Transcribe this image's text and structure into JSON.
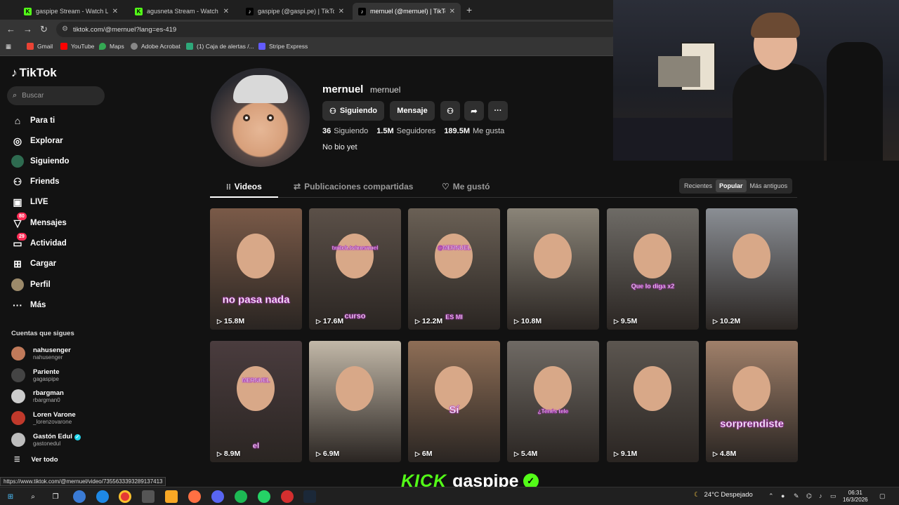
{
  "browser": {
    "tabs": [
      {
        "title": "gaspipe Stream - Watch Live o",
        "favicon": "kick-icon",
        "active": false
      },
      {
        "title": "agusneta Stream - Watch Live o",
        "favicon": "kick-icon",
        "active": false
      },
      {
        "title": "gaspipe (@gaspi.pe) | TikTok",
        "favicon": "tiktok-icon",
        "active": false
      },
      {
        "title": "mernuel (@mernuel) | TikTok",
        "favicon": "tiktok-icon",
        "active": true
      }
    ],
    "url": "tiktok.com/@mernuel?lang=es-419",
    "bookmarks": [
      "Gmail",
      "YouTube",
      "Maps",
      "Adobe Acrobat",
      "(1) Caja de alertas /...",
      "Stripe Express"
    ],
    "status_url": "https://www.tiktok.com/@mernuel/video/7355633393289137413"
  },
  "sidebar": {
    "logo": "TikTok",
    "search_placeholder": "Buscar",
    "nav": [
      {
        "label": "Para ti",
        "icon": "home-icon"
      },
      {
        "label": "Explorar",
        "icon": "compass-icon"
      },
      {
        "label": "Siguiendo",
        "icon": "following-icon"
      },
      {
        "label": "Friends",
        "icon": "friends-icon"
      },
      {
        "label": "LIVE",
        "icon": "live-icon"
      },
      {
        "label": "Mensajes",
        "icon": "messages-icon",
        "badge": "80"
      },
      {
        "label": "Actividad",
        "icon": "activity-icon",
        "badge": "29"
      },
      {
        "label": "Cargar",
        "icon": "upload-icon"
      },
      {
        "label": "Perfil",
        "icon": "profile-icon"
      },
      {
        "label": "Más",
        "icon": "more-icon"
      }
    ],
    "following_title": "Cuentas que sigues",
    "accounts": [
      {
        "name": "nahusenger",
        "handle": "nahusenger",
        "verified": false
      },
      {
        "name": "Pariente",
        "handle": "gagaspipe",
        "verified": false
      },
      {
        "name": "rbargman",
        "handle": "rbargman0",
        "verified": false
      },
      {
        "name": "Loren Varone",
        "handle": "_lorenzovarone",
        "verified": false
      },
      {
        "name": "Gastón Edul",
        "handle": "gastonedul",
        "verified": true
      }
    ],
    "see_all": "Ver todo"
  },
  "profile": {
    "username": "mernuel",
    "nickname": "mernuel",
    "buttons": {
      "following": "Siguiendo",
      "message": "Mensaje"
    },
    "stats": [
      {
        "value": "36",
        "label": "Siguiendo"
      },
      {
        "value": "1.5M",
        "label": "Seguidores"
      },
      {
        "value": "189.5M",
        "label": "Me gusta"
      }
    ],
    "bio": "No bio yet",
    "tabs": [
      "Videos",
      "Publicaciones compartidas",
      "Me gustó"
    ],
    "sort_options": [
      "Recientes",
      "Popular",
      "Más antiguos"
    ],
    "sort_selected": "Popular"
  },
  "videos": [
    {
      "views": "15.8M",
      "caption": "no pasa nada",
      "bg": "#7a5a48"
    },
    {
      "views": "17.6M",
      "caption": "curso",
      "overlay": "twitch.tv/mernuel",
      "bg": "#5b5048"
    },
    {
      "views": "12.2M",
      "caption": "ES MI",
      "overlay": "@MERNUEL",
      "bg": "#6a6055"
    },
    {
      "views": "10.8M",
      "caption": "",
      "bg": "#8a8478"
    },
    {
      "views": "9.5M",
      "caption": "Que lo diga x2",
      "bg": "#6e6b66"
    },
    {
      "views": "10.2M",
      "caption": "",
      "bg": "#8a8e94"
    },
    {
      "views": "8.9M",
      "caption": "el",
      "overlay": "MERNUEL",
      "bg": "#4a3c3e"
    },
    {
      "views": "6.9M",
      "caption": "",
      "bg": "#c2b8a8"
    },
    {
      "views": "6M",
      "caption": "Sí",
      "bg": "#8e6e56"
    },
    {
      "views": "5.4M",
      "caption": "¿Tenés tele",
      "bg": "#6f6a64"
    },
    {
      "views": "9.1M",
      "caption": "",
      "bg": "#5c5650"
    },
    {
      "views": "4.8M",
      "caption": "sorprendiste",
      "bg": "#a0806a"
    }
  ],
  "overlay": {
    "kick_label": "KICK",
    "channel": "gaspipe"
  },
  "taskbar": {
    "weather": "24°C Despejado",
    "time": "06:31",
    "date": "16/3/2026"
  }
}
